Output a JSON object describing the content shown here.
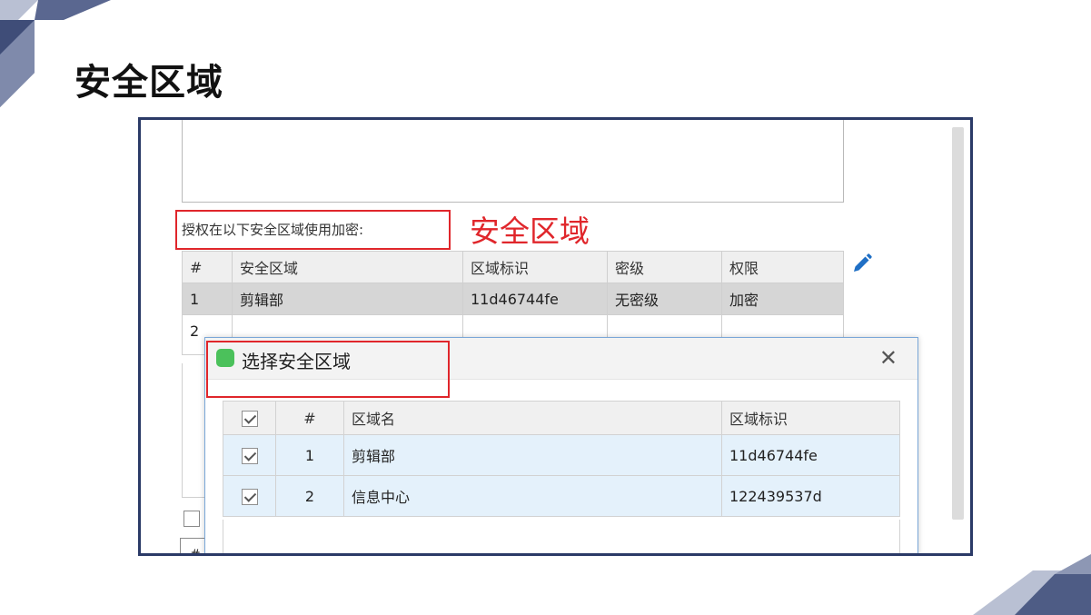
{
  "slide": {
    "title": "安全区域"
  },
  "form": {
    "auth_label": "授权在以下安全区域使用加密:",
    "annotation": "安全区域",
    "table": {
      "headers": [
        "#",
        "安全区域",
        "区域标识",
        "密级",
        "权限"
      ],
      "rows": [
        [
          "1",
          "剪辑部",
          "11d46744fe",
          "无密级",
          "加密"
        ],
        [
          "2",
          "",
          "",
          "",
          ""
        ]
      ]
    },
    "footer_mark": "#"
  },
  "dialog": {
    "title": "选择安全区域",
    "close_glyph": "✕",
    "headers": [
      "",
      "#",
      "区域名",
      "区域标识"
    ],
    "rows": [
      {
        "checked": true,
        "index": "1",
        "name": "剪辑部",
        "id": "11d46744fe"
      },
      {
        "checked": true,
        "index": "2",
        "name": "信息中心",
        "id": "122439537d"
      }
    ]
  },
  "colors": {
    "frame": "#2b3a67",
    "highlight": "#e0262b",
    "pencil": "#1f6fc5",
    "selected_row": "#e4f1fb",
    "deco_dark": "#3f4d78",
    "deco_light": "#b9c0d3"
  },
  "icons": {
    "edit": "pencil-icon",
    "close": "close-icon",
    "app": "app-icon",
    "check": "checkbox-icon"
  }
}
